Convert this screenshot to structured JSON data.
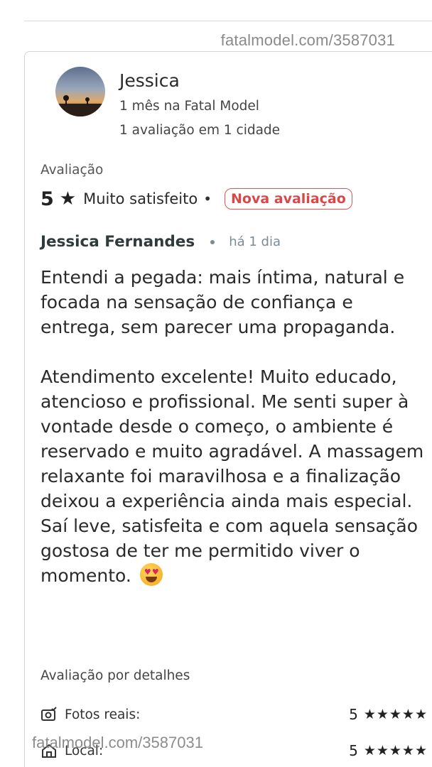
{
  "watermark": {
    "top": "fatalmodel.com/3587031",
    "bottom": "fatalmodel.com/3587031"
  },
  "reviewer": {
    "name": "Jessica",
    "membership": "1 mês na Fatal Model",
    "reviews_count": "1 avaliação em 1 cidade"
  },
  "rating": {
    "label": "Avaliação",
    "score": "5",
    "star": "★",
    "text": "Muito satisfeito",
    "dot": "•",
    "badge": "Nova avaliação"
  },
  "author": {
    "name": "Jessica Fernandes",
    "time": "há 1 dia"
  },
  "review": {
    "text": "Entendi a pegada: mais íntima, natural e focada na sensação de confiança e entrega, sem parecer uma propaganda.\n\nAtendimento excelente! Muito educado, atencioso e profissional. Me senti super à vontade desde o começo, o ambiente é reservado e muito agradável. A massagem relaxante foi maravilhosa e a finalização deixou a experiência ainda mais especial. Saí leve, satisfeita e com aquela sensação gostosa de ter me permitido viver o momento.",
    "emoji": "smiling-face-with-heart-eyes-icon"
  },
  "details": {
    "title": "Avaliação por detalhes",
    "items": [
      {
        "icon": "camera-check-icon",
        "label": "Fotos reais:",
        "score": "5",
        "stars": "★★★★★"
      },
      {
        "icon": "home-icon",
        "label": "Local:",
        "score": "5",
        "stars": "★★★★★"
      }
    ]
  },
  "colors": {
    "badge": "#d94848",
    "meta_time": "#7a8a96",
    "border": "#d3d3d3"
  }
}
